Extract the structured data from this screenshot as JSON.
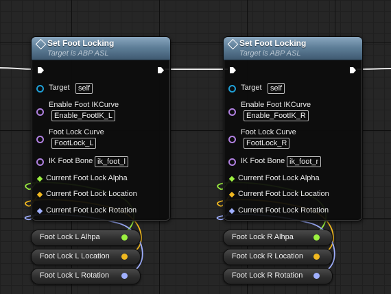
{
  "nodes": [
    {
      "title": "Set Foot Locking",
      "subtitle": "Target is ABP ASL",
      "target_label": "Target",
      "target_value": "self",
      "curve_label_1": "Enable Foot IKCurve",
      "curve_value_1": "Enable_FootIK_L",
      "curve_label_2": "Foot Lock Curve",
      "curve_value_2": "FootLock_L",
      "bone_label": "IK Foot Bone",
      "bone_value": "ik_foot_l",
      "alpha_label": "Current Foot Lock Alpha",
      "location_label": "Current Foot Lock Location",
      "rotation_label": "Current Foot Lock Rotation"
    },
    {
      "title": "Set Foot Locking",
      "subtitle": "Target is ABP ASL",
      "target_label": "Target",
      "target_value": "self",
      "curve_label_1": "Enable Foot IKCurve",
      "curve_value_1": "Enable_FootIK_R",
      "curve_label_2": "Foot Lock Curve",
      "curve_value_2": "FootLock_R",
      "bone_label": "IK Foot Bone",
      "bone_value": "ik_foot_r",
      "alpha_label": "Current Foot Lock Alpha",
      "location_label": "Current Foot Lock Location",
      "rotation_label": "Current Foot Lock Rotation"
    }
  ],
  "variables": [
    [
      "Foot Lock L Alhpa",
      "Foot Lock L Location",
      "Foot Lock L Rotation"
    ],
    [
      "Foot Lock R Alhpa",
      "Foot Lock R Location",
      "Foot Lock R Rotation"
    ]
  ],
  "colors": {
    "float_pin": "#9cf040",
    "vector_pin": "#f0b820",
    "rotator_pin": "#a0b0ff",
    "object_pin": "#1fa0d8",
    "name_pin": "#b080e0",
    "exec_pin": "#ffffff"
  }
}
